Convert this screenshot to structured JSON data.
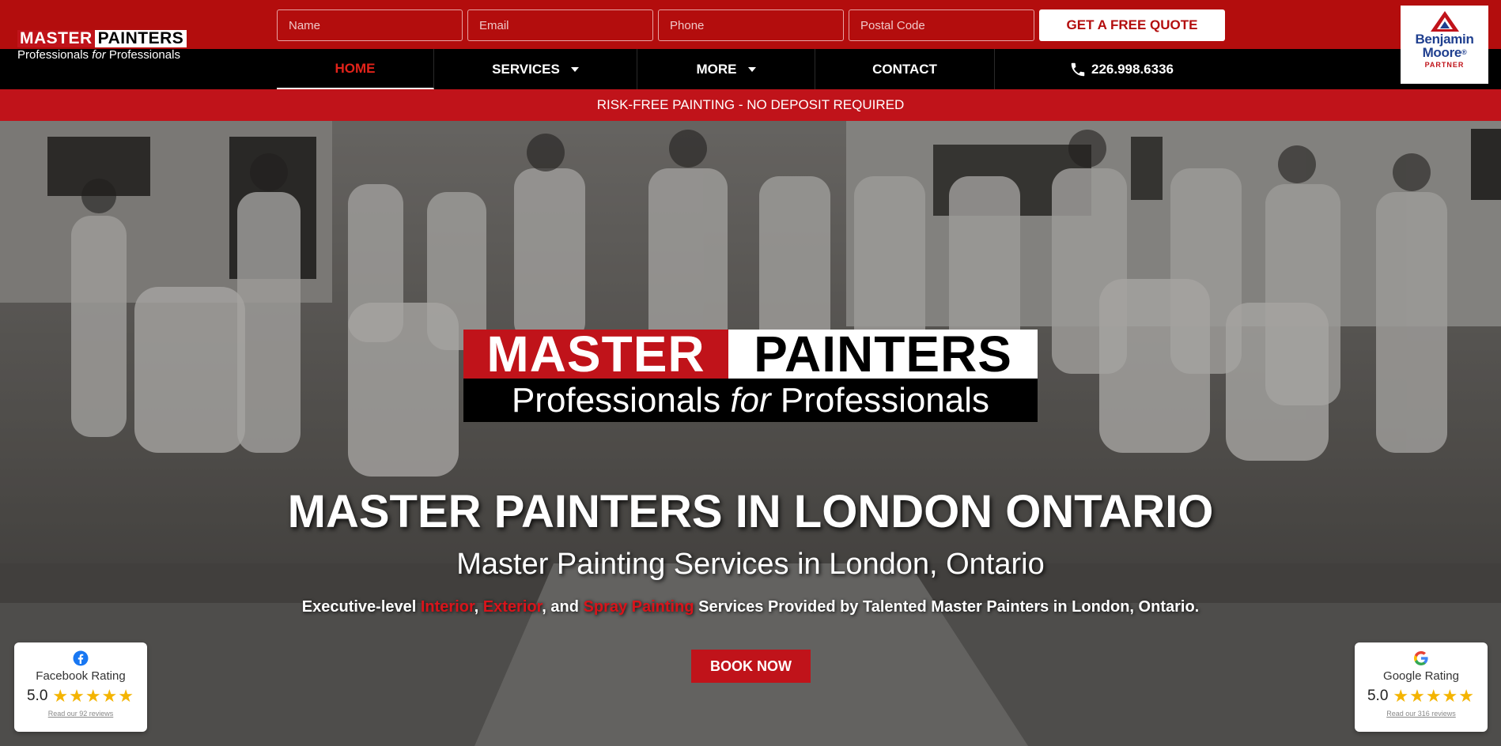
{
  "header": {
    "logo": {
      "master": "MASTER",
      "painters": "PAINTERS",
      "tagline_a": "Professionals ",
      "tagline_b": "for",
      "tagline_c": " Professionals"
    },
    "form": {
      "name_placeholder": "Name",
      "email_placeholder": "Email",
      "phone_placeholder": "Phone",
      "postal_placeholder": "Postal Code",
      "submit_label": "GET A FREE QUOTE"
    },
    "nav": {
      "home": "HOME",
      "services": "SERVICES",
      "more": "MORE",
      "contact": "CONTACT",
      "phone": "226.998.6336"
    },
    "partner": {
      "name_line1": "Benjamin",
      "name_line2": "Moore",
      "reg": "®",
      "label": "PARTNER"
    }
  },
  "announcement": "RISK-FREE PAINTING - NO DEPOSIT REQUIRED",
  "hero": {
    "logo": {
      "master": "MASTER",
      "painters": "PAINTERS",
      "tagline_a": "Professionals ",
      "tagline_b": "for",
      "tagline_c": " Professionals"
    },
    "title": "MASTER PAINTERS IN LONDON ONTARIO",
    "subtitle": "Master Painting Services in London, Ontario",
    "desc": {
      "prefix": "Executive-level ",
      "interior": "Interior",
      "sep1": ", ",
      "exterior": "Exterior",
      "sep2": ", and ",
      "spray": "Spray Painting",
      "suffix": " Services Provided by Talented Master Painters in London, Ontario."
    },
    "cta": "BOOK NOW"
  },
  "ratings": {
    "facebook": {
      "label": "Facebook Rating",
      "score": "5.0",
      "stars": "★★★★★",
      "link": "Read our 92 reviews",
      "value": 5
    },
    "google": {
      "label": "Google Rating",
      "score": "5.0",
      "stars": "★★★★★",
      "link": "Read our 316 reviews",
      "value": 5
    }
  },
  "colors": {
    "brand_red": "#c0131a",
    "header_red": "#b30d0d",
    "nav_black": "#000000",
    "partner_blue": "#1f3f8f",
    "star_gold": "#f4b400"
  },
  "icons": {
    "phone": "phone-icon",
    "facebook": "facebook-icon",
    "google": "google-icon",
    "caret": "chevron-down-icon"
  }
}
